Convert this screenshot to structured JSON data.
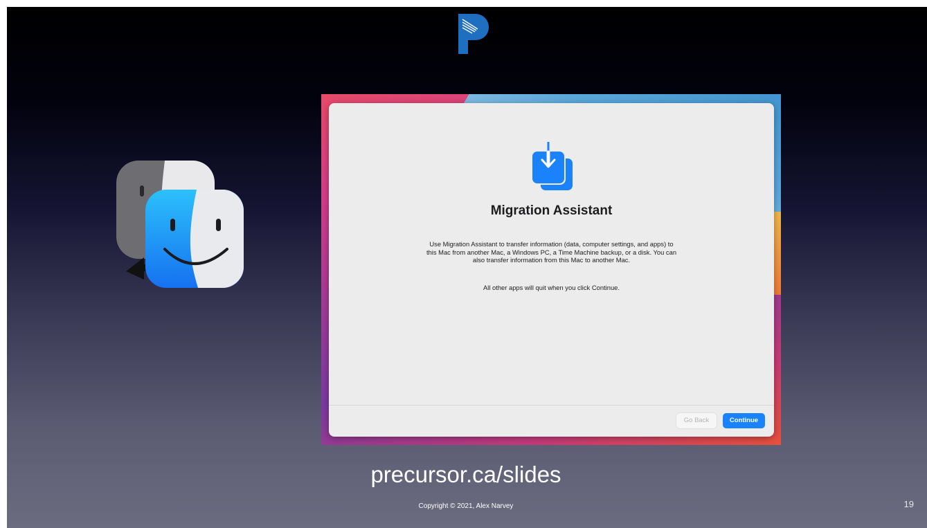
{
  "slide": {
    "logo_icon": "precursor-p-logo",
    "migration_icon": "migration-assistant-finder-icon",
    "url": "precursor.ca/slides",
    "copyright": "Copyright © 2021, Alex Narvey",
    "page_number": "19"
  },
  "migration_window": {
    "icon": "migration-download-icon",
    "title": "Migration Assistant",
    "description": "Use Migration Assistant to transfer information (data, computer settings, and apps) to this Mac from another Mac, a Windows PC, a Time Machine backup, or a disk. You can also transfer information from this Mac to another Mac.",
    "note": "All other apps will quit when you click Continue.",
    "go_back_label": "Go Back",
    "continue_label": "Continue"
  },
  "colors": {
    "accent": "#1a82fb",
    "logo_blue": "#1f6fc0"
  }
}
